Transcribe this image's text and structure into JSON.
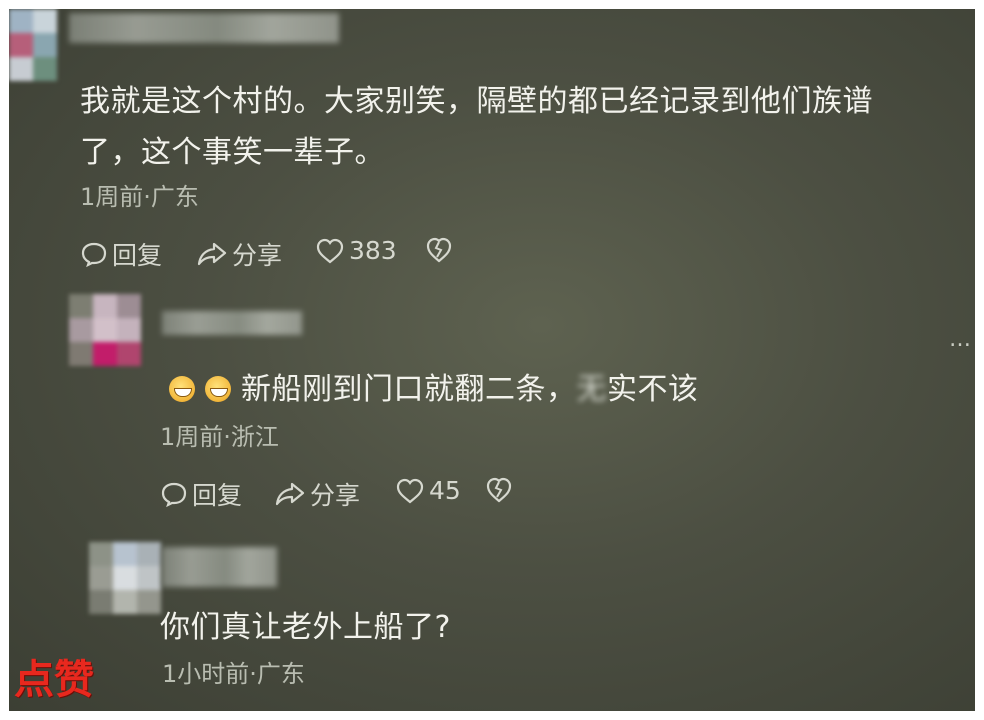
{
  "comments": [
    {
      "text_line1": "我就是这个村的。大家别笑，隔壁的都已经记录到他们族谱",
      "text_line2": "了，这个事笑一辈子。",
      "meta": "1周前·广东",
      "reply_label": "回复",
      "share_label": "分享",
      "likes": "383"
    },
    {
      "text_before": "新船刚到门口就翻二条，",
      "text_blurred": "无",
      "text_after": "实不该",
      "meta": "1周前·浙江",
      "reply_label": "回复",
      "share_label": "分享",
      "likes": "45"
    },
    {
      "text": "你们真让老外上船了?",
      "meta": "1小时前·广东"
    }
  ],
  "more_menu": "…",
  "watermark_label": "点赞",
  "colors": {
    "text": "#f2f2ec",
    "meta": "#b9bdb1",
    "badge": "#e8281e"
  },
  "icons": [
    "reply-icon",
    "share-icon",
    "heart-icon",
    "dislike-icon",
    "grin-emoji-icon"
  ]
}
